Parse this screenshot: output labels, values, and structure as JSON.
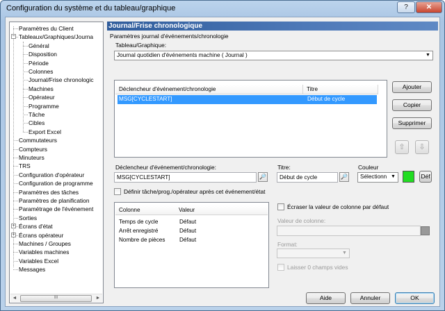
{
  "window": {
    "title": "Configuration du système et du tableau/graphique",
    "help_btn": "?",
    "close_btn": "✕"
  },
  "tree": {
    "items": [
      {
        "label": "Paramètres du Client",
        "level": 0,
        "expander": ""
      },
      {
        "label": "Tableaux/Graphiques/Journa",
        "level": 0,
        "expander": "−"
      },
      {
        "label": "Général",
        "level": 1,
        "expander": ""
      },
      {
        "label": "Disposition",
        "level": 1,
        "expander": ""
      },
      {
        "label": "Période",
        "level": 1,
        "expander": ""
      },
      {
        "label": "Colonnes",
        "level": 1,
        "expander": ""
      },
      {
        "label": "Journal/Frise chronologic",
        "level": 1,
        "expander": ""
      },
      {
        "label": "Machines",
        "level": 1,
        "expander": ""
      },
      {
        "label": "Opérateur",
        "level": 1,
        "expander": ""
      },
      {
        "label": "Programme",
        "level": 1,
        "expander": ""
      },
      {
        "label": "Tâche",
        "level": 1,
        "expander": ""
      },
      {
        "label": "Cibles",
        "level": 1,
        "expander": ""
      },
      {
        "label": "Export Excel",
        "level": 1,
        "expander": ""
      },
      {
        "label": "Commutateurs",
        "level": 0,
        "expander": ""
      },
      {
        "label": "Compteurs",
        "level": 0,
        "expander": ""
      },
      {
        "label": "Minuteurs",
        "level": 0,
        "expander": ""
      },
      {
        "label": "TRS",
        "level": 0,
        "expander": ""
      },
      {
        "label": "Configuration d'opérateur",
        "level": 0,
        "expander": ""
      },
      {
        "label": "Configuration de programme",
        "level": 0,
        "expander": ""
      },
      {
        "label": "Paramètres des tâches",
        "level": 0,
        "expander": ""
      },
      {
        "label": "Paramètres de planification",
        "level": 0,
        "expander": ""
      },
      {
        "label": "Paramétrage de l'événement",
        "level": 0,
        "expander": ""
      },
      {
        "label": "Sorties",
        "level": 0,
        "expander": ""
      },
      {
        "label": "Écrans d'état",
        "level": 0,
        "expander": "+"
      },
      {
        "label": "Écrans opérateur",
        "level": 0,
        "expander": "+"
      },
      {
        "label": "Machines / Groupes",
        "level": 0,
        "expander": ""
      },
      {
        "label": "Variables machines",
        "level": 0,
        "expander": ""
      },
      {
        "label": "Variables Excel",
        "level": 0,
        "expander": ""
      },
      {
        "label": "Messages",
        "level": 0,
        "expander": ""
      }
    ],
    "selected_index": 6,
    "scroll_left": "◄",
    "scroll_right": "►",
    "scroll_grip": "III"
  },
  "panel": {
    "header": "Journal/Frise chronologique",
    "section_label": "Paramètres journal d'événements/chronologie",
    "chart_label": "Tableau/Graphique:",
    "chart_value": "Journal quotidien d'événements machine  ( Journal )",
    "events_table": {
      "headers": [
        "Déclencheur d'événement/chronologie",
        "Titre"
      ],
      "rows": [
        [
          "MSG[CYCLESTART]",
          "Début de cycle"
        ]
      ]
    },
    "add_btn": "Ajouter",
    "copy_btn": "Copier",
    "delete_btn": "Supprimer",
    "up_btn": "⇧",
    "down_btn": "⇩",
    "trigger_label": "Déclencheur d'événement/chronologie:",
    "trigger_value": "MSG[CYCLESTART]",
    "title_label": "Titre:",
    "title_value": "Début de cycle",
    "browse_icon": "🔎",
    "color_label": "Couleur",
    "color_value": "Sélectionn",
    "color_swatch": "#22dd22",
    "def_btn": "Déf",
    "define_checkbox": "Définir tâche/prog./opérateur après cet événement/état",
    "columns_table": {
      "headers": [
        "Colonne",
        "Valeur"
      ],
      "rows": [
        [
          "Temps de cycle",
          "Défaut"
        ],
        [
          "Arrêt enregistré",
          "Défaut"
        ],
        [
          "Nombre de pièces",
          "Défaut"
        ]
      ]
    },
    "overwrite_checkbox": "Écraser la valeur de colonne par défaut",
    "column_value_label": "Valeur de colonne:",
    "format_label": "Format:",
    "empty_checkbox": "Laisser 0 champs vides"
  },
  "footer": {
    "help_btn": "Aide",
    "cancel_btn": "Annuler",
    "ok_btn": "OK"
  }
}
